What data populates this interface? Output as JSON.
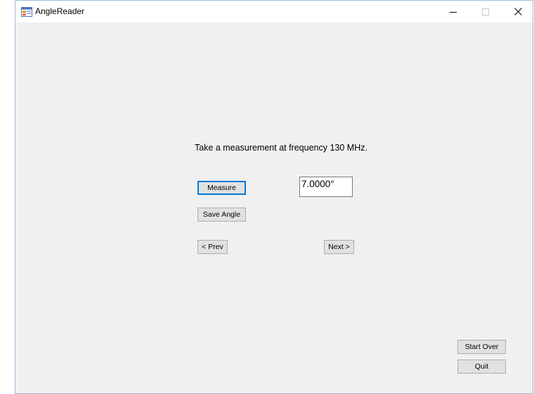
{
  "window": {
    "title": "AngleReader",
    "icon": "windows-form-app-icon",
    "controls": {
      "minimize": "minimize-icon",
      "maximize": "maximize-icon",
      "close": "close-icon"
    }
  },
  "main": {
    "instruction": "Take a measurement at frequency 130 MHz.",
    "measure_label": "Measure",
    "angle_value": "7.0000°",
    "save_angle_label": "Save Angle",
    "prev_label": "< Prev",
    "next_label": "Next >",
    "start_over_label": "Start Over",
    "quit_label": "Quit"
  },
  "colors": {
    "window_background": "#f0f0f0",
    "button_face": "#e1e1e1",
    "default_button_border": "#0078d7",
    "window_border": "#9fbcd6"
  }
}
